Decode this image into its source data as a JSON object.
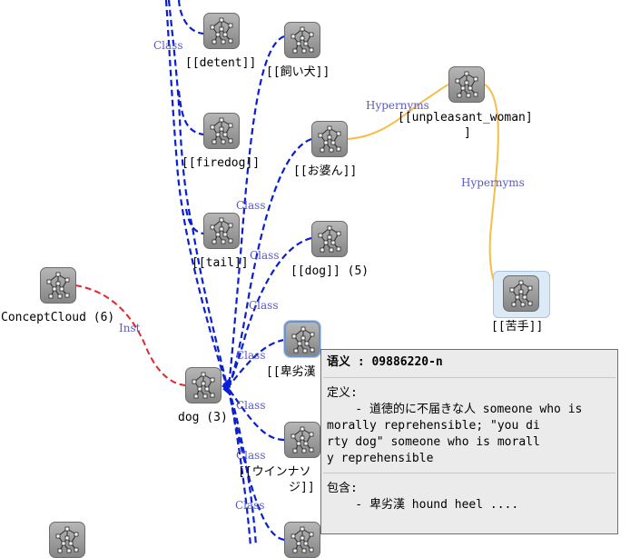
{
  "nodes": [
    {
      "name": "node-detent",
      "label": "[[detent]]"
    },
    {
      "name": "node-kaiinu",
      "label": "[[飼い犬]]"
    },
    {
      "name": "node-firedog",
      "label": "[[firedog]]"
    },
    {
      "name": "node-obaasan",
      "label": "[[お婆ん]]"
    },
    {
      "name": "node-unpleasant-woman",
      "label_line1": "[[unpleasant_woman]",
      "label_line2": "]"
    },
    {
      "name": "node-tail",
      "label": "[[tail]]"
    },
    {
      "name": "node-dog-5",
      "label": "[[dog]] (5)"
    },
    {
      "name": "node-nigate",
      "label": "[[苦手]]"
    },
    {
      "name": "node-conceptcloud",
      "label": "ConceptCloud (6)"
    },
    {
      "name": "node-hikyoukan",
      "label": "[[卑劣漢"
    },
    {
      "name": "node-dog-3",
      "label": "dog (3)"
    },
    {
      "name": "node-wiener",
      "label_line1": "[[ウインナソ",
      "label_line2": "ジ]]"
    }
  ],
  "edge_labels": {
    "class_1": "Class",
    "class_2": "Class",
    "class_3": "Class",
    "class_4": "Class",
    "class_5": "Class",
    "class_6": "Class",
    "class_7": "Class",
    "inst": "Inst",
    "hypernyms_1": "Hypernyms",
    "hypernyms_2": "Hypernyms"
  },
  "tooltip": {
    "header": "语义 : 09886220-n",
    "definition_heading": "定义:",
    "definition_lines": [
      "    - 道徳的に不届きな人 someone who is",
      "morally reprehensible; \"you di",
      "rty dog\" someone who is morall",
      "y reprehensible"
    ],
    "includes_heading": "包含:",
    "includes_line": "    - 卑劣漢 hound heel ...."
  },
  "colors": {
    "class_edge": "#0a1fd2",
    "inst_edge": "#e0282e",
    "hypernym_edge": "#f5be4a",
    "edge_label": "#5a5ac6",
    "tooltip_bg": "#ebebeb"
  },
  "icons": {
    "node": "network-graph-icon"
  }
}
